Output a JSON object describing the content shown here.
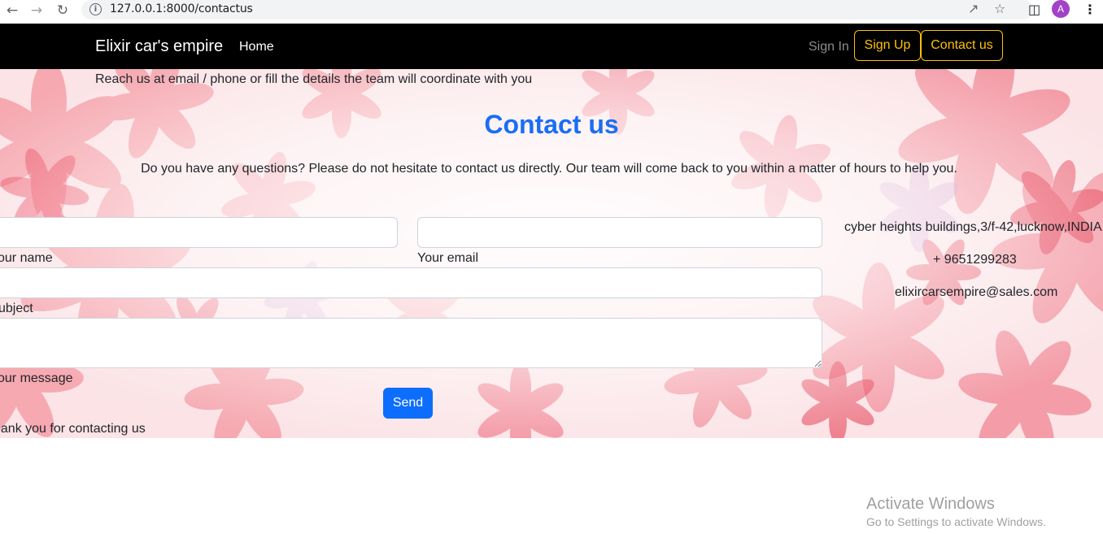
{
  "browser": {
    "url": "127.0.0.1:8000/contactus",
    "avatar_letter": "A",
    "icons": [
      "back-arrow-icon",
      "forward-arrow-icon",
      "reload-icon",
      "info-icon",
      "share-icon",
      "star-icon",
      "sidepanel-icon",
      "menu-dots-icon"
    ]
  },
  "navbar": {
    "brand": "Elixir car's empire",
    "home": "Home",
    "sign_in": "Sign In",
    "sign_up": "Sign Up",
    "contact": "Contact us",
    "accent": "#ffc107"
  },
  "page": {
    "intro": "Reach us at email / phone or fill the details the team will coordinate with you",
    "title": "Contact us",
    "lead": "Do you have any questions? Please do not hesitate to contact us directly. Our team will come back to you within a matter of hours to help you.",
    "title_color": "#1a6ef5"
  },
  "form": {
    "name_label": "our name",
    "email_label": "Your email",
    "subject_label": "ubject",
    "message_label": "our message",
    "send_label": "Send",
    "thanks": "hank you for contacting us",
    "button_color": "#0d6efd"
  },
  "contact_info": {
    "address": "cyber heights buildings,3/f-42,lucknow,INDIA",
    "phone": "+ 9651299283",
    "email": "elixircarsempire@sales.com"
  },
  "watermark": {
    "title": "Activate Windows",
    "subtitle": "Go to Settings to activate Windows."
  }
}
